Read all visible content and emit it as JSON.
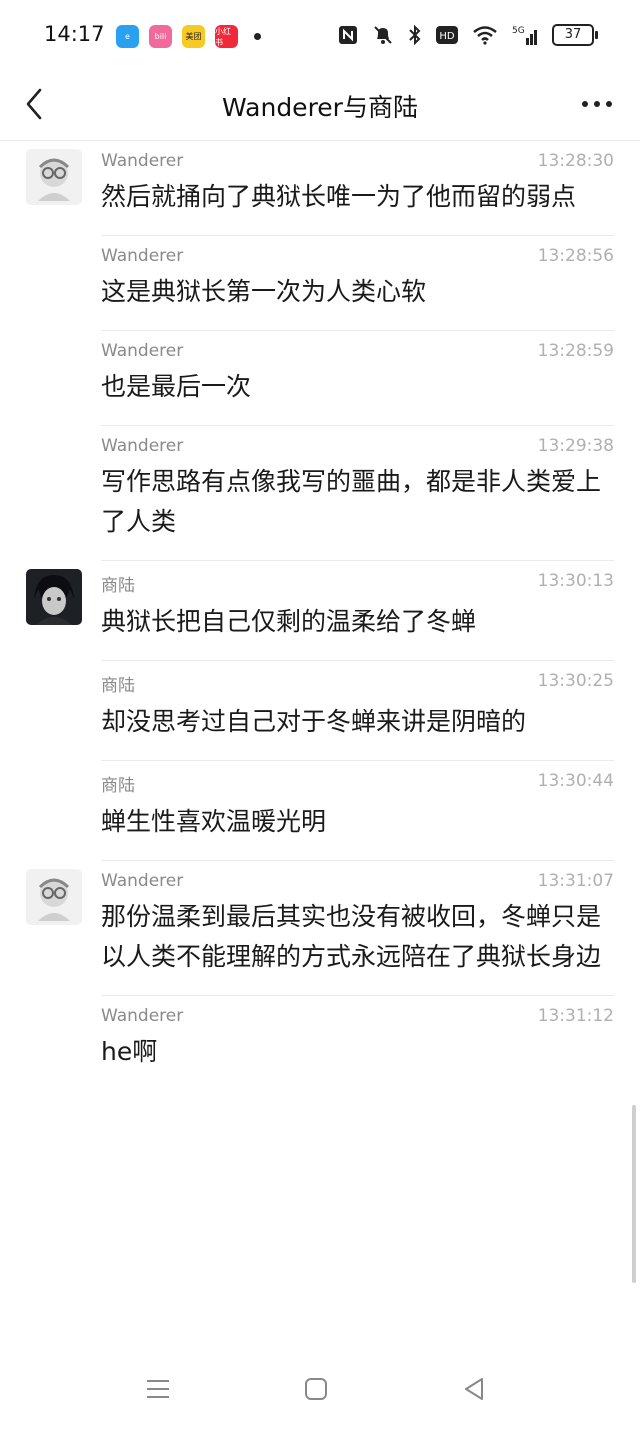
{
  "status_bar": {
    "time": "14:17",
    "app_icons": [
      {
        "name": "app-icon-e",
        "label": "e",
        "color": "#2aa0f0"
      },
      {
        "name": "app-icon-bilibili",
        "label": "bili",
        "color": "#f06a9c"
      },
      {
        "name": "app-icon-meituan",
        "label": "美团",
        "color": "#f7c923"
      },
      {
        "name": "app-icon-xiaohongshu",
        "label": "小红书",
        "color": "#f02a3a"
      }
    ],
    "battery": "37",
    "network": "5G"
  },
  "header": {
    "title": "Wanderer与商陆",
    "back_icon": "chevron-left-icon",
    "more_icon": "more-dots-icon"
  },
  "messages": [
    {
      "sender": "Wanderer",
      "time": "13:28:30",
      "text": "然后就捅向了典狱长唯一为了他而留的弱点",
      "avatar": "light"
    },
    {
      "sender": "Wanderer",
      "time": "13:28:56",
      "text": "这是典狱长第一次为人类心软",
      "avatar": ""
    },
    {
      "sender": "Wanderer",
      "time": "13:28:59",
      "text": "也是最后一次",
      "avatar": ""
    },
    {
      "sender": "Wanderer",
      "time": "13:29:38",
      "text": "写作思路有点像我写的噩曲，都是非人类爱上了人类",
      "avatar": ""
    },
    {
      "sender": "商陆",
      "time": "13:30:13",
      "text": "典狱长把自己仅剩的温柔给了冬蝉",
      "avatar": "dark"
    },
    {
      "sender": "商陆",
      "time": "13:30:25",
      "text": "却没思考过自己对于冬蝉来讲是阴暗的",
      "avatar": ""
    },
    {
      "sender": "商陆",
      "time": "13:30:44",
      "text": "蝉生性喜欢温暖光明",
      "avatar": ""
    },
    {
      "sender": "Wanderer",
      "time": "13:31:07",
      "text": "那份温柔到最后其实也没有被收回，冬蝉只是以人类不能理解的方式永远陪在了典狱长身边",
      "avatar": "light"
    },
    {
      "sender": "Wanderer",
      "time": "13:31:12",
      "text": "he啊",
      "avatar": ""
    }
  ],
  "system_nav": {
    "menu_icon": "menu-icon",
    "home_icon": "home-square-icon",
    "back_icon": "back-triangle-icon"
  }
}
